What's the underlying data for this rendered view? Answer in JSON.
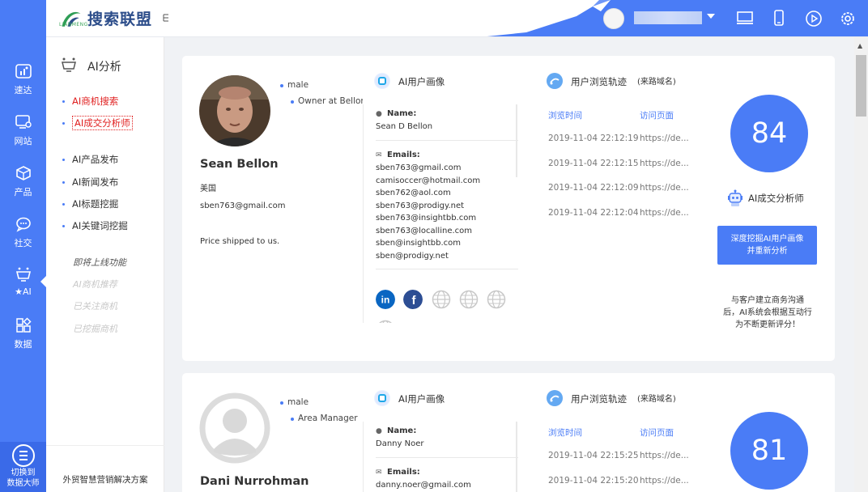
{
  "header": {
    "logo_title": "搜索联盟",
    "logo_sub": "LIANMENG"
  },
  "rail": {
    "items": [
      {
        "label": "速达",
        "icon": "chart-icon"
      },
      {
        "label": "网站",
        "icon": "monitor-gear-icon"
      },
      {
        "label": "产品",
        "icon": "box-icon"
      },
      {
        "label": "社交",
        "icon": "chat-icon"
      },
      {
        "label": "★AI",
        "icon": "ai-robot-icon"
      },
      {
        "label": "数据",
        "icon": "grid-icon"
      }
    ],
    "switch_label_1": "切换到",
    "switch_label_2": "数据大师"
  },
  "sidebar": {
    "heading": "AI分析",
    "items": [
      {
        "label": "AI商机搜索",
        "state": "active"
      },
      {
        "label": "AI成交分析师",
        "state": "selected"
      },
      {
        "label": "AI产品发布",
        "state": "normal"
      },
      {
        "label": "AI新闻发布",
        "state": "normal"
      },
      {
        "label": "AI标题挖掘",
        "state": "normal"
      },
      {
        "label": "AI关键词挖掘",
        "state": "normal"
      }
    ],
    "coming_soon": "即将上线功能",
    "soon_items": [
      "AI商机推荐",
      "已关注商机",
      "已挖掘商机"
    ],
    "footer": "外贸智慧营销解决方案"
  },
  "labels": {
    "profile": "AI用户画像",
    "trail": "用户浏览轨迹",
    "trail_note": "(来路域名)",
    "name_label": "Name:",
    "emails_label": "Emails:",
    "col_time": "浏览时间",
    "col_page": "访问页面",
    "analyst": "AI成交分析师",
    "deep_btn_1": "深度挖掘AI用户画像",
    "deep_btn_2": "并重新分析",
    "note_1": "与客户建立商务沟通",
    "note_2": "后，AI系统会根据互动行",
    "note_3": "为不断更新评分！"
  },
  "cards": [
    {
      "gender": "male",
      "title": "Owner at Bellon",
      "name": "Sean Bellon",
      "country": "美国",
      "email": "sben763@gmail.com",
      "note": "Price shipped to us.",
      "full_name": "Sean D Bellon",
      "emails": [
        "sben763@gmail.com",
        "camisoccer@hotmail.com",
        "sben762@aol.com",
        "sben763@prodigy.net",
        "sben763@insightbb.com",
        "sben763@localline.com",
        "sben@insightbb.com",
        "sben@prodigy.net"
      ],
      "visits": [
        {
          "time": "2019-11-04 22:12:19",
          "page": "https://de..."
        },
        {
          "time": "2019-11-04 22:12:15",
          "page": "https://de..."
        },
        {
          "time": "2019-11-04 22:12:09",
          "page": "https://de..."
        },
        {
          "time": "2019-11-04 22:12:04",
          "page": "https://de..."
        }
      ],
      "score": "84",
      "social": [
        "linkedin-icon",
        "facebook-icon",
        "globe-icon",
        "globe-icon",
        "globe-icon",
        "globe-icon"
      ]
    },
    {
      "gender": "male",
      "title": "Area Manager FOS...",
      "name": "Dani Nurrohman",
      "full_name": "Danny Noer",
      "emails": [
        "danny.noer@gmail.com"
      ],
      "visits": [
        {
          "time": "2019-11-04 22:15:25",
          "page": "https://de..."
        },
        {
          "time": "2019-11-04 22:15:20",
          "page": "https://de..."
        }
      ],
      "score": "81"
    }
  ],
  "colors": {
    "accent": "#4a7cf6",
    "active": "#e02020"
  }
}
